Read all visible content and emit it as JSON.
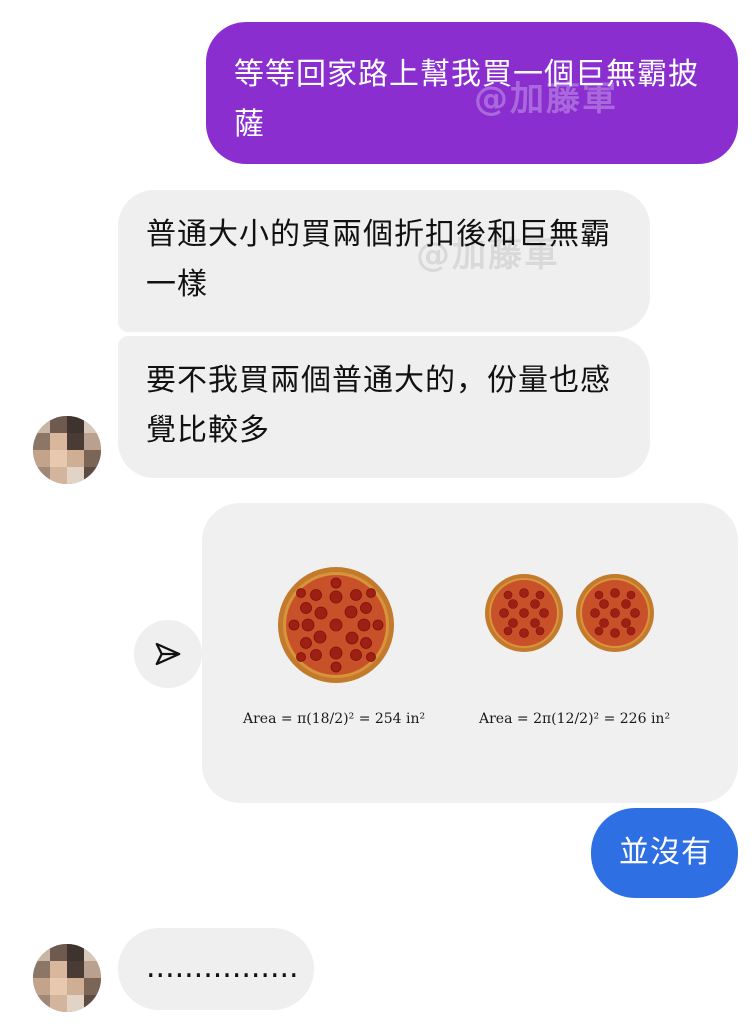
{
  "messages": {
    "sent_1": {
      "line1": "等等回家路上幫我買一個巨無霸披",
      "line2": "薩"
    },
    "received_1": {
      "line1": "普通大小的買兩個折扣後和巨無霸",
      "line2": "一樣"
    },
    "received_2": {
      "line1": "要不我買兩個普通大的，份量也感",
      "line2": "覺比較多"
    },
    "image_message": {
      "formula_left": "Area = π(18/2)² = 254 in²",
      "formula_right": "Area = 2π(12/2)² = 226 in²"
    },
    "sent_2": {
      "text": "並沒有"
    },
    "received_3": {
      "text": "................"
    }
  },
  "watermark": "@加藤軍",
  "colors": {
    "sent_bubble_purple": "#8a2ed0",
    "sent_bubble_blue": "#2f6fe4",
    "received_bubble": "#efefef"
  },
  "icons": {
    "share": "send-paper-plane-icon",
    "avatar": "pixelated-avatar"
  }
}
